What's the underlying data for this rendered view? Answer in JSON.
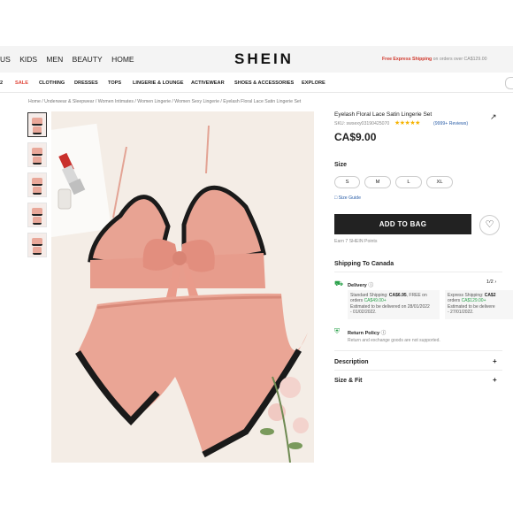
{
  "header": {
    "nav_items": [
      "US",
      "KIDS",
      "MEN",
      "BEAUTY",
      "HOME"
    ],
    "logo": "SHEIN",
    "promo_highlight": "Free Express Shipping",
    "promo_rest": " on orders over CA$129.00"
  },
  "category_nav": [
    "2",
    "SALE",
    "CLOTHING",
    "DRESSES",
    "TOPS",
    "LINGERIE & LOUNGE",
    "ACTIVEWEAR",
    "SHOES & ACCESSORIES",
    "EXPLORE"
  ],
  "breadcrumb": "Home  /  Underwear & Sleepwear  /  Women Intimates  /  Women Lingerie  /  Women Sexy Lingerie  /  Eyelash Floral Lace Satin Lingerie Set",
  "product": {
    "title": "Eyelash Floral Lace Satin Lingerie Set",
    "sku": "SKU: swsexy03190425070",
    "stars": "★★★★★",
    "reviews": "(9999+ Reviews)",
    "price": "CA$9.00",
    "size_label": "Size",
    "sizes": [
      "S",
      "M",
      "L",
      "XL"
    ],
    "size_guide": "Size Guide",
    "add_to_bag": "ADD TO BAG",
    "earn_points": "Earn 7 SHEIN Points"
  },
  "shipping": {
    "heading": "Shipping To Canada",
    "delivery_label": "Delivery",
    "pager": "1/2",
    "standard": {
      "line1a": "Standard Shipping: ",
      "line1b": "CA$6.95",
      "line1c": ", FREE on",
      "line2a": "orders ",
      "line2b": "CA$49.00+",
      "line3": "Estimated to be delivered on 28/01/2022",
      "line4": "- 01/02/2022."
    },
    "express": {
      "line1a": "Express Shipping: ",
      "line1b": "CA$2",
      "line2a": "orders ",
      "line2b": "CA$129.00+",
      "line3": "Estimated to be delivere",
      "line4": "- 27/01/2022."
    },
    "return_label": "Return Policy",
    "return_note": "Return and exchange goods are not supported."
  },
  "sections": {
    "description": "Description",
    "size_fit": "Size & Fit",
    "plus": "+"
  },
  "colors": {
    "brand_dark": "#222222",
    "sale_red": "#e0473b",
    "link_blue": "#2c5fa8",
    "success_green": "#2aa14a",
    "star_gold": "#f6b300"
  }
}
